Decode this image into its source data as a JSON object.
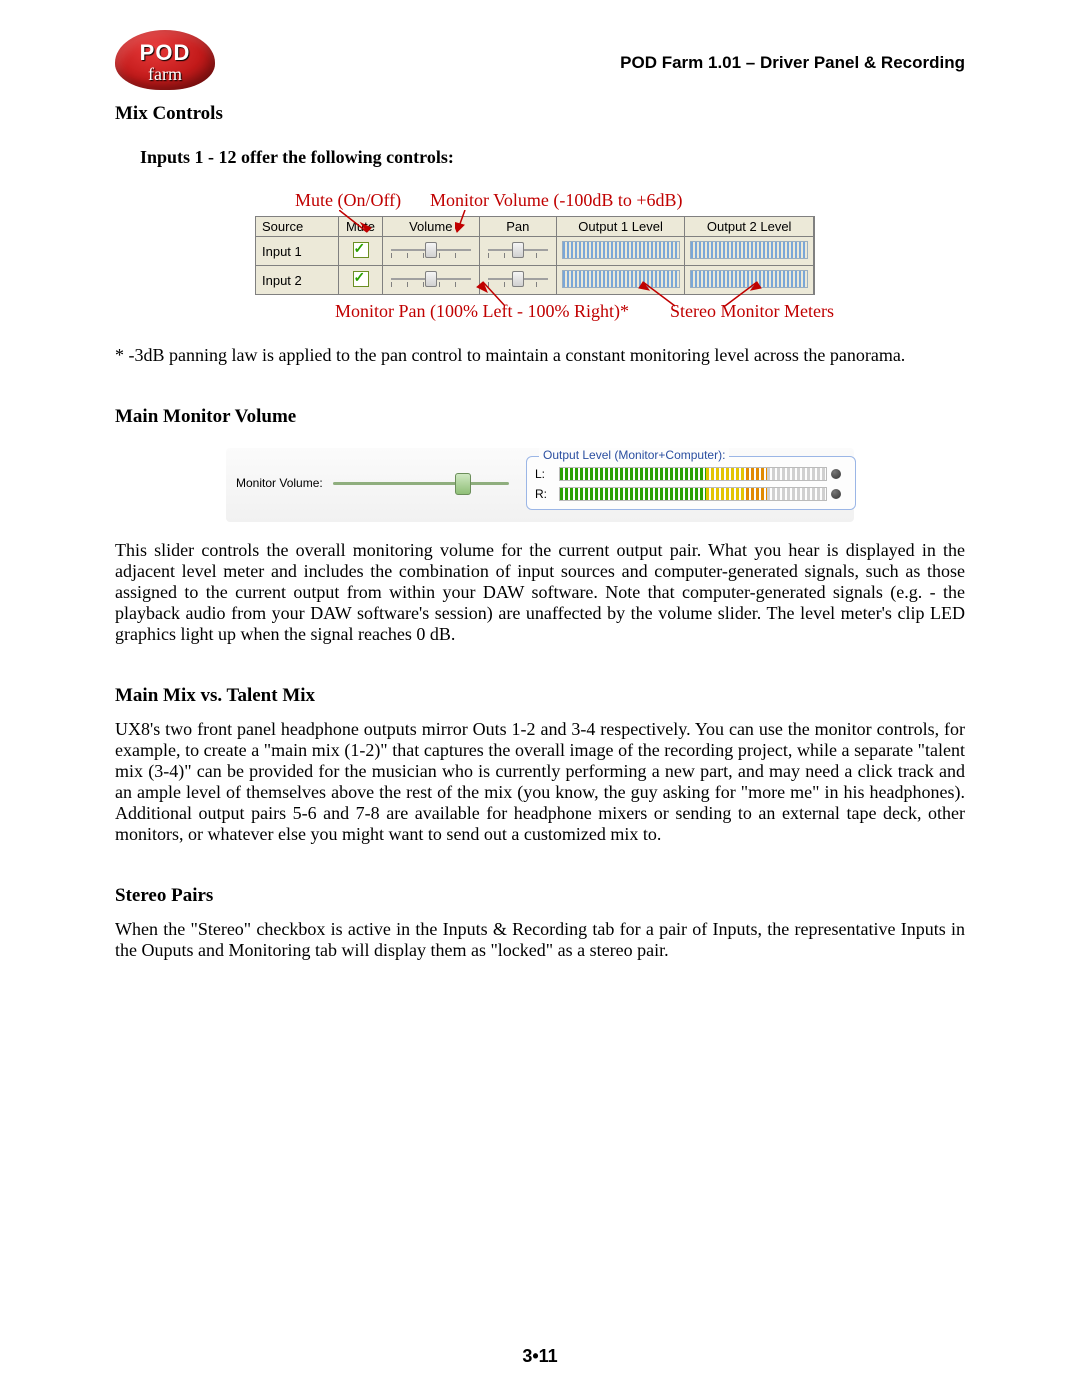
{
  "logo": {
    "line1": "POD",
    "line2": "farm"
  },
  "header_right": "POD Farm 1.01 – Driver Panel & Recording",
  "mix_controls_title": "Mix Controls",
  "inputs_subhead": "Inputs 1 - 12 offer the following controls:",
  "fig1": {
    "top_labels": {
      "mute": "Mute (On/Off)",
      "monvol": "Monitor Volume (-100dB to +6dB)"
    },
    "columns": {
      "source": "Source",
      "mute": "Mute",
      "volume": "Volume",
      "pan": "Pan",
      "out1": "Output 1 Level",
      "out2": "Output 2 Level"
    },
    "rows": [
      {
        "source": "Input 1",
        "mute": true,
        "vol_pct": 50,
        "pan_pct": 50
      },
      {
        "source": "Input 2",
        "mute": true,
        "vol_pct": 50,
        "pan_pct": 50
      }
    ],
    "bottom_labels": {
      "pan": "Monitor Pan (100% Left - 100% Right)*",
      "meters": "Stereo Monitor Meters"
    }
  },
  "panning_note": "* -3dB panning law is applied to the pan control to maintain a constant monitoring level across the panorama.",
  "main_mon_vol_title": "Main Monitor Volume",
  "fig2": {
    "mv_label": "Monitor Volume:",
    "legend": "Output Level (Monitor+Computer):",
    "l_label": "L:",
    "r_label": "R:"
  },
  "mon_vol_para": "This slider controls the overall monitoring volume for the current output pair. What you hear is displayed in the adjacent level meter and includes the combination of input sources and computer-generated signals, such as those assigned to the current output from within your DAW software. Note that computer-generated signals (e.g. - the playback audio from your DAW software's session) are unaffected by the volume slider. The level meter's clip LED graphics light up when the signal reaches 0 dB.",
  "mmix_title": "Main Mix vs. Talent Mix",
  "mmix_para": "UX8's two front panel headphone outputs mirror Outs 1-2 and 3-4 respectively. You can use the monitor controls, for example, to create a \"main mix (1-2)\" that captures the overall image of the recording project, while a separate \"talent mix (3-4)\" can be provided for the musician who is currently performing a new part, and may need a click track and an ample level of themselves above the rest of the mix (you know, the guy asking for \"more me\" in his headphones). Additional output pairs 5-6 and 7-8 are available for headphone mixers or sending to an external tape deck, other monitors, or whatever else you might want to send out a customized mix to.",
  "stereo_title": "Stereo Pairs",
  "stereo_para": "When the \"Stereo\" checkbox is active in the Inputs & Recording tab for a pair of Inputs, the representative Inputs in the Ouputs and Monitoring tab will display them as \"locked\" as a stereo pair.",
  "page_number": "3•11"
}
